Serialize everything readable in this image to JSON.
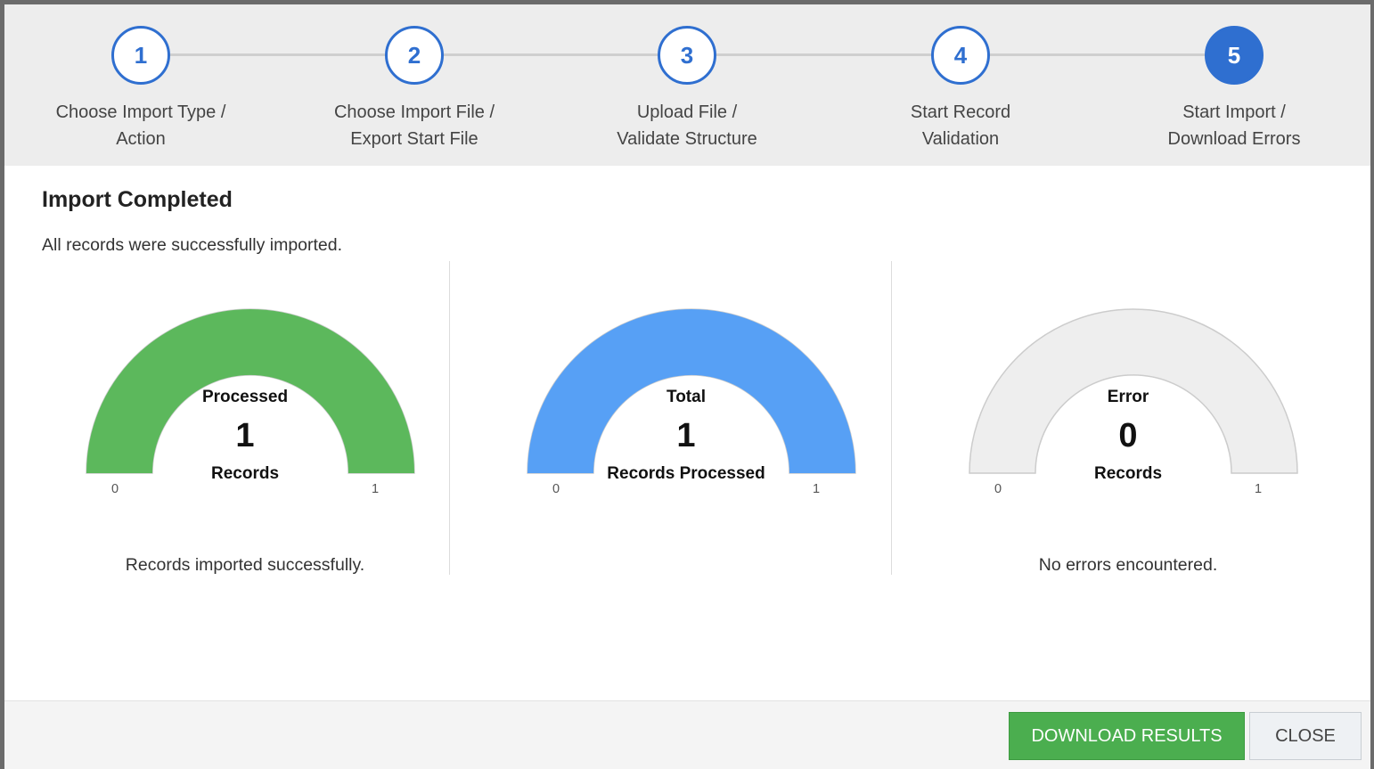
{
  "steps": [
    {
      "number": "1",
      "label": "Choose Import Type /\nAction",
      "active": false
    },
    {
      "number": "2",
      "label": "Choose Import File /\nExport Start File",
      "active": false
    },
    {
      "number": "3",
      "label": "Upload File /\nValidate Structure",
      "active": false
    },
    {
      "number": "4",
      "label": "Start Record\nValidation",
      "active": false
    },
    {
      "number": "5",
      "label": "Start Import /\nDownload Errors",
      "active": true
    }
  ],
  "header": {
    "title": "Import Completed",
    "subtitle": "All records were successfully imported."
  },
  "gauges": [
    {
      "label": "Processed",
      "value": "1",
      "unit": "Records",
      "min": "0",
      "max": "1",
      "fraction": 1,
      "color": "#5cb85c",
      "caption": "Records imported successfully."
    },
    {
      "label": "Total",
      "value": "1",
      "unit": "Records Processed",
      "min": "0",
      "max": "1",
      "fraction": 1,
      "color": "#57a0f5",
      "caption": ""
    },
    {
      "label": "Error",
      "value": "0",
      "unit": "Records",
      "min": "0",
      "max": "1",
      "fraction": 0,
      "color": "#eeeeee",
      "caption": "No errors encountered."
    }
  ],
  "footer": {
    "download_label": "DOWNLOAD RESULTS",
    "close_label": "CLOSE"
  }
}
